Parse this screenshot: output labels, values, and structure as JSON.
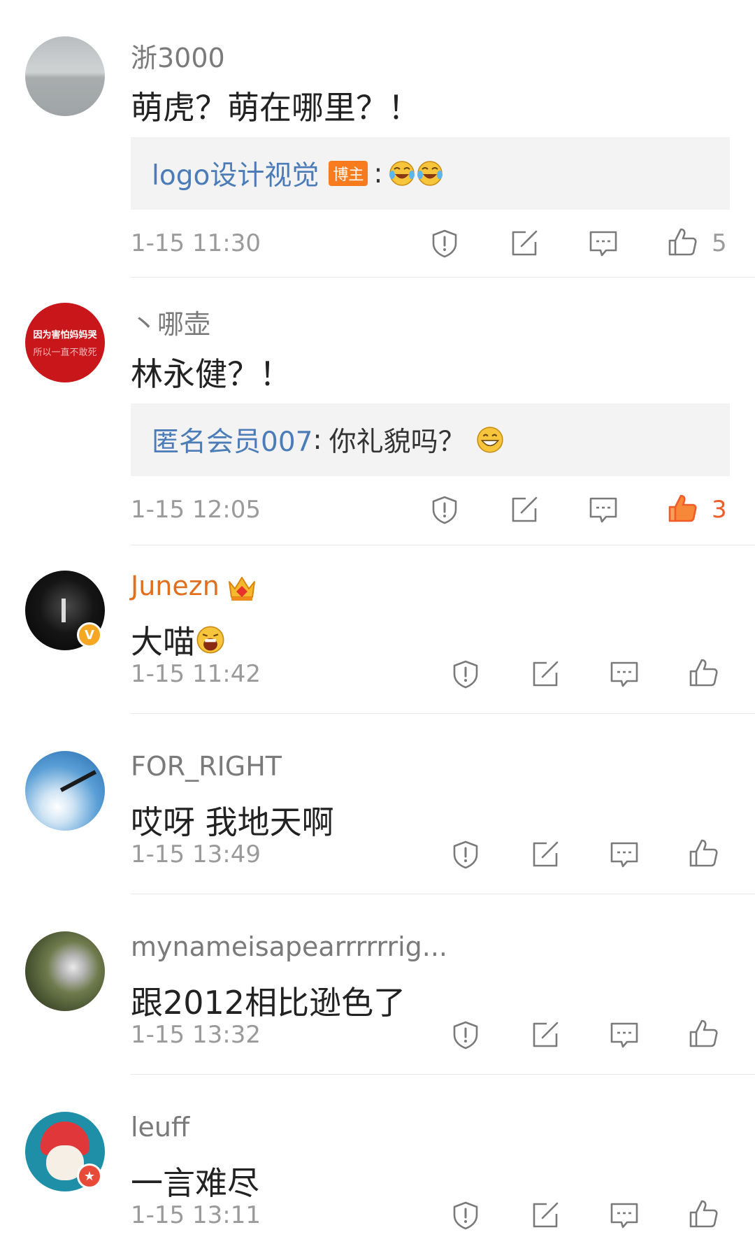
{
  "comments": [
    {
      "username": "浙3000",
      "content": "萌虎？萌在哪里？！",
      "reply": {
        "author": "logo设计视觉",
        "tag": "博主",
        "separator": ":",
        "emojis": [
          "laugh-cry-emoji",
          "laugh-cry-emoji"
        ]
      },
      "time": "1-15 11:30",
      "likes": "5",
      "liked": false
    },
    {
      "username": "丶哪壶",
      "avatar_text": [
        "因为害怕妈妈哭",
        "所以一直不敢死"
      ],
      "content": "林永健？！",
      "reply": {
        "author": "匿名会员007",
        "separator": ":",
        "text": "你礼貌吗？",
        "emojis": [
          "grin-emoji"
        ]
      },
      "time": "1-15 12:05",
      "likes": "3",
      "liked": true
    },
    {
      "username": "Junezn",
      "content": "大喵",
      "time": "1-15 11:42",
      "likes": "",
      "liked": false
    },
    {
      "username": "FOR_RIGHT",
      "content": "哎呀 我地天啊",
      "time": "1-15 13:49",
      "likes": "",
      "liked": false
    },
    {
      "username": "mynameisapearrrrrrig...",
      "content": "跟2012相比逊色了",
      "time": "1-15 13:32",
      "likes": "",
      "liked": false
    },
    {
      "username": "leuff",
      "content": "一言难尽",
      "time": "1-15 13:11",
      "likes": "",
      "liked": false
    }
  ],
  "colors": {
    "accent_orange": "#f15b27",
    "reply_author_blue": "#4c7cb8",
    "host_tag_bg": "#f87c1d",
    "vip_name_gold": "#e0701e"
  }
}
